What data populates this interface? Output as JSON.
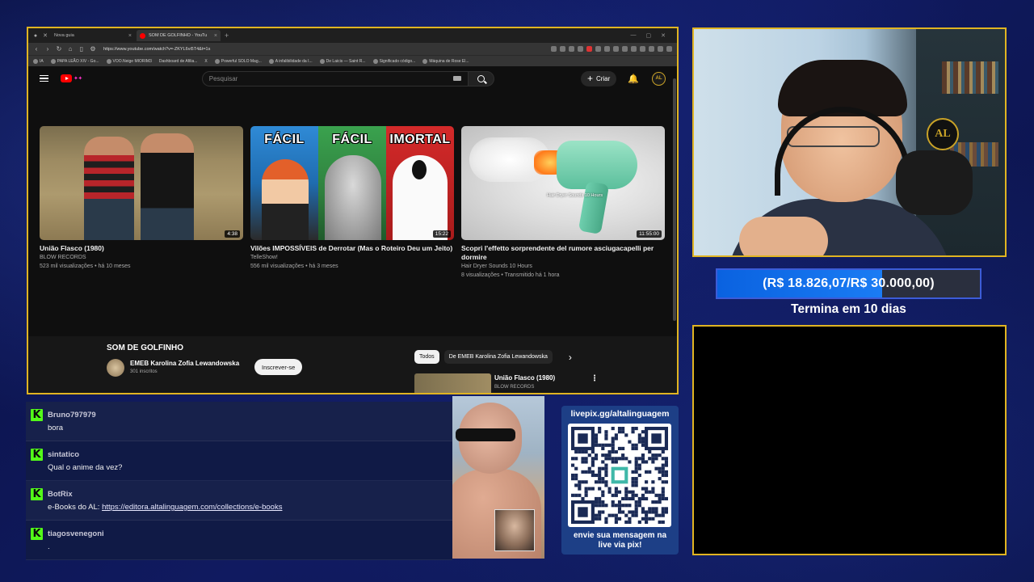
{
  "browser": {
    "tabs": [
      {
        "title": "Nova guia",
        "active": false
      },
      {
        "title": "SOM DE GOLFINHO - YouTu",
        "active": true
      }
    ],
    "url": "https://www.youtube.com/watch?v=-ZKYL6vi5T4&t=1s",
    "bookmarks": [
      "IA",
      "PAPA LEÃO XIV - Go...",
      "VOO.Neige MIORIM3",
      "Dashboard de Afilia...",
      "X",
      "Powerful SOLO Mag...",
      "A infalibilidade da I...",
      "De Laicis — Saint R...",
      "Significado código...",
      "Máquina de Rose El..."
    ]
  },
  "youtube": {
    "search_placeholder": "Pesquisar",
    "create_label": "Criar",
    "videos": [
      {
        "title": "União Flasco (1980)",
        "channel": "BLOW RECORDS",
        "meta": "523 mil visualizações • há 10 meses",
        "duration": "4:38"
      },
      {
        "title": "Vilões IMPOSSÍVEIS de Derrotar (Mas o Roteiro Deu um Jeito)",
        "channel": "TelleShow!",
        "meta": "556 mil visualizações • há 3 meses",
        "duration": "15:22",
        "thumb_labels": [
          "FÁCIL",
          "FÁCIL",
          "IMORTAL"
        ]
      },
      {
        "title": "Scopri l'effetto sorprendente del rumore asciugacapelli per dormire",
        "channel": "Hair Dryer Sounds 10 Hours",
        "meta": "8 visualizações • Transmitido há 1 hora",
        "duration": "11:55:00",
        "thumb_caption": "Hair Dryer Sounds 10 Hours"
      }
    ],
    "current_video": {
      "title": "SOM DE GOLFINHO",
      "channel": "EMEB Karolina Zofia Lewandowska",
      "subs": "301 inscritos",
      "subscribe_label": "Inscrever-se"
    },
    "chips": [
      "Todos",
      "De EMEB Karolina Zofia Lewandowska"
    ],
    "related": {
      "title": "União Flasco (1980)",
      "channel": "BLOW RECORDS"
    }
  },
  "goal": {
    "text": "(R$ 18.826,07/R$ 30.000,00)",
    "progress": 0.6275,
    "subtext": "Termina em 10 dias"
  },
  "chat": [
    {
      "user": "Bruno797979",
      "text": "bora"
    },
    {
      "user": "sintatico",
      "text": "Qual o anime da vez?"
    },
    {
      "user": "BotRix",
      "text": "e-Books do AL: ",
      "link": "https://editora.altalinguagem.com/collections/e-books"
    },
    {
      "user": "tiagosvenegoni",
      "text": "."
    }
  ],
  "pix": {
    "title": "livepix.gg/altalinguagem",
    "caption_line1": "envie sua mensagem na",
    "caption_line2": "live via pix!"
  },
  "webcam": {
    "logo_text": "AL"
  },
  "colors": {
    "frame": "#e0b422",
    "kick": "#53fc18",
    "goal_fill": "#0a62e0",
    "youtube_red": "#ff0000"
  }
}
